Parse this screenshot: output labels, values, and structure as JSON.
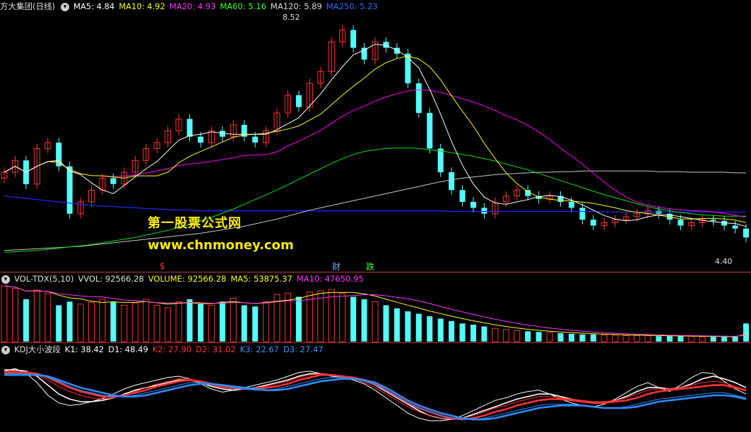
{
  "price_header": {
    "title": "方大集团(日线)",
    "ma5": "MA5: 4.84",
    "ma10": "MA10: 4.92",
    "ma20": "MA20: 4.93",
    "ma60": "MA60: 5.16",
    "ma120": "MA120: 5.89",
    "ma250": "MA250: 5.23"
  },
  "vol_header": {
    "title": "VOL-TDX(5,10)",
    "vvol": "VVOL: 92566.28",
    "volume": "VOLUME: 92566.28",
    "ma5": "MA5: 53875.37",
    "ma10": "MA10: 47650.95"
  },
  "kdj_header": {
    "title": "KDJ大小波段",
    "k1": "K1: 38.42",
    "d1": "D1: 48.49",
    "k2": "K2: 27.90",
    "d2": "D2: 31.02",
    "k3": "K3: 22.67",
    "d3": "D3: 27.47"
  },
  "watermark": {
    "line1": "第一股票公式网",
    "line2": "www.chnmoney.com"
  },
  "markers": {
    "dollar": "$",
    "cai": "财",
    "die": "跌"
  },
  "colors": {
    "up": "#ff3232",
    "down": "#54ffff",
    "ma5": "#ffffff",
    "ma10": "#ffff00",
    "ma20": "#ff00ff",
    "ma60": "#00e400",
    "ma120": "#c8c8c8",
    "ma250": "#2828ff"
  },
  "chart_data": [
    {
      "type": "candlestick",
      "title": "方大集团(日线)",
      "y_range": [
        4.4,
        8.52
      ],
      "annotations": [
        {
          "label": "8.52",
          "value": 8.52
        },
        {
          "label": "4.40",
          "value": 4.4
        }
      ],
      "close": [
        5.9,
        6.1,
        5.7,
        6.3,
        6.4,
        6.0,
        5.2,
        5.4,
        5.6,
        5.8,
        5.7,
        5.9,
        6.1,
        6.3,
        6.4,
        6.6,
        6.8,
        6.5,
        6.4,
        6.6,
        6.5,
        6.7,
        6.5,
        6.4,
        6.6,
        6.9,
        7.2,
        7.0,
        7.4,
        7.6,
        8.1,
        8.3,
        8.0,
        7.8,
        8.1,
        8.0,
        7.9,
        7.4,
        6.9,
        6.3,
        5.9,
        5.6,
        5.4,
        5.3,
        5.2,
        5.4,
        5.5,
        5.6,
        5.5,
        5.45,
        5.5,
        5.4,
        5.3,
        5.1,
        5.0,
        5.05,
        5.1,
        5.15,
        5.2,
        5.25,
        5.2,
        5.1,
        5.0,
        5.05,
        5.1,
        5.08,
        5.0,
        4.95,
        4.8
      ],
      "ma60": [
        4.55,
        4.56,
        4.57,
        4.58,
        4.6,
        4.62,
        4.64,
        4.66,
        4.68,
        4.71,
        4.74,
        4.77,
        4.8,
        4.84,
        4.88,
        4.92,
        4.97,
        5.02,
        5.08,
        5.14,
        5.21,
        5.28,
        5.36,
        5.44,
        5.52,
        5.6,
        5.69,
        5.78,
        5.87,
        5.96,
        6.05,
        6.13,
        6.2,
        6.25,
        6.28,
        6.3,
        6.31,
        6.31,
        6.3,
        6.28,
        6.26,
        6.23,
        6.2,
        6.17,
        6.13,
        6.09,
        6.04,
        5.99,
        5.94,
        5.88,
        5.82,
        5.76,
        5.7,
        5.64,
        5.58,
        5.52,
        5.47,
        5.42,
        5.37,
        5.32,
        5.28,
        5.25,
        5.22,
        5.2,
        5.18,
        5.17,
        5.16,
        5.16,
        5.16
      ],
      "ma120": [
        4.58,
        4.59,
        4.6,
        4.61,
        4.62,
        4.63,
        4.64,
        4.65,
        4.67,
        4.69,
        4.71,
        4.73,
        4.75,
        4.77,
        4.79,
        4.81,
        4.83,
        4.85,
        4.87,
        4.9,
        4.93,
        4.96,
        4.99,
        5.03,
        5.07,
        5.11,
        5.16,
        5.21,
        5.26,
        5.3,
        5.34,
        5.38,
        5.42,
        5.46,
        5.5,
        5.54,
        5.58,
        5.62,
        5.66,
        5.7,
        5.74,
        5.77,
        5.8,
        5.82,
        5.84,
        5.86,
        5.87,
        5.88,
        5.89,
        5.9,
        5.9,
        5.91,
        5.91,
        5.92,
        5.92,
        5.92,
        5.92,
        5.92,
        5.92,
        5.92,
        5.91,
        5.91,
        5.91,
        5.9,
        5.9,
        5.9,
        5.9,
        5.89,
        5.89
      ],
      "ma250": [
        5.5,
        5.48,
        5.46,
        5.44,
        5.42,
        5.4,
        5.38,
        5.36,
        5.34,
        5.33,
        5.32,
        5.31,
        5.3,
        5.29,
        5.28,
        5.27,
        5.26,
        5.26,
        5.25,
        5.25,
        5.25,
        5.25,
        5.25,
        5.25,
        5.25,
        5.25,
        5.25,
        5.25,
        5.25,
        5.25,
        5.25,
        5.25,
        5.25,
        5.25,
        5.25,
        5.25,
        5.25,
        5.25,
        5.25,
        5.25,
        5.25,
        5.24,
        5.24,
        5.24,
        5.24,
        5.24,
        5.24,
        5.24,
        5.24,
        5.24,
        5.24,
        5.24,
        5.24,
        5.24,
        5.24,
        5.23,
        5.23,
        5.23,
        5.23,
        5.23,
        5.23,
        5.23,
        5.23,
        5.23,
        5.23,
        5.23,
        5.23,
        5.23,
        5.23
      ]
    },
    {
      "type": "bar",
      "title": "VOL-TDX(5,10)",
      "values": [
        92,
        88,
        70,
        85,
        80,
        60,
        66,
        62,
        65,
        70,
        66,
        60,
        64,
        70,
        60,
        56,
        66,
        70,
        62,
        60,
        66,
        72,
        60,
        58,
        66,
        78,
        80,
        74,
        82,
        84,
        86,
        80,
        74,
        70,
        66,
        60,
        55,
        50,
        46,
        42,
        38,
        34,
        30,
        28,
        25,
        22,
        20,
        18,
        17,
        16,
        15,
        14,
        13,
        12,
        12,
        11,
        11,
        10,
        10,
        10,
        9,
        9,
        9,
        9,
        8,
        8,
        8,
        8,
        30
      ]
    },
    {
      "type": "line",
      "title": "KDJ大小波段",
      "y_range": [
        0,
        100
      ],
      "series": [
        {
          "name": "K1",
          "values": [
            88,
            92,
            85,
            70,
            50,
            38,
            34,
            36,
            40,
            45,
            52,
            60,
            66,
            70,
            74,
            78,
            80,
            76,
            68,
            60,
            55,
            58,
            62,
            66,
            70,
            74,
            80,
            86,
            88,
            84,
            80,
            78,
            74,
            68,
            58,
            46,
            34,
            22,
            14,
            10,
            10,
            12,
            18,
            26,
            34,
            42,
            46,
            52,
            56,
            58,
            52,
            44,
            38,
            34,
            32,
            36,
            44,
            54,
            64,
            70,
            62,
            56,
            66,
            78,
            86,
            84,
            72,
            60,
            52
          ]
        },
        {
          "name": "D1",
          "values": [
            90,
            90,
            88,
            80,
            66,
            52,
            44,
            40,
            40,
            42,
            46,
            52,
            58,
            62,
            66,
            70,
            74,
            74,
            70,
            64,
            60,
            58,
            60,
            62,
            66,
            70,
            74,
            80,
            84,
            84,
            82,
            80,
            78,
            74,
            66,
            56,
            46,
            36,
            26,
            18,
            14,
            12,
            14,
            20,
            26,
            32,
            38,
            44,
            48,
            52,
            52,
            48,
            44,
            40,
            38,
            38,
            42,
            48,
            56,
            62,
            62,
            60,
            62,
            68,
            76,
            80,
            76,
            70,
            62
          ]
        },
        {
          "name": "K2",
          "values": [
            88,
            88,
            86,
            82,
            74,
            64,
            56,
            50,
            46,
            44,
            46,
            50,
            56,
            62,
            68,
            72,
            76,
            76,
            72,
            66,
            62,
            60,
            60,
            62,
            64,
            68,
            72,
            78,
            82,
            84,
            82,
            80,
            76,
            70,
            62,
            52,
            42,
            32,
            24,
            18,
            14,
            12,
            14,
            18,
            24,
            30,
            34,
            40,
            44,
            48,
            48,
            46,
            44,
            42,
            40,
            40,
            42,
            46,
            52,
            58,
            60,
            60,
            62,
            66,
            70,
            72,
            70,
            64,
            58
          ]
        },
        {
          "name": "D2",
          "values": [
            86,
            86,
            86,
            84,
            78,
            70,
            62,
            56,
            52,
            48,
            48,
            50,
            54,
            58,
            64,
            68,
            72,
            74,
            72,
            68,
            64,
            62,
            60,
            60,
            62,
            64,
            68,
            74,
            78,
            82,
            82,
            80,
            78,
            74,
            68,
            58,
            48,
            38,
            30,
            24,
            18,
            14,
            12,
            14,
            18,
            24,
            28,
            34,
            38,
            42,
            44,
            44,
            42,
            40,
            38,
            38,
            40,
            42,
            46,
            52,
            56,
            58,
            60,
            62,
            64,
            66,
            66,
            62,
            58
          ]
        },
        {
          "name": "K3",
          "values": [
            84,
            84,
            84,
            82,
            78,
            72,
            64,
            58,
            54,
            50,
            48,
            48,
            50,
            54,
            58,
            62,
            66,
            70,
            70,
            68,
            66,
            62,
            60,
            58,
            58,
            60,
            64,
            68,
            72,
            76,
            78,
            78,
            76,
            72,
            66,
            58,
            48,
            38,
            30,
            24,
            18,
            14,
            12,
            12,
            14,
            18,
            22,
            26,
            30,
            34,
            36,
            36,
            36,
            34,
            32,
            30,
            30,
            32,
            36,
            40,
            44,
            46,
            48,
            50,
            52,
            54,
            54,
            50,
            46
          ]
        },
        {
          "name": "D3",
          "values": [
            82,
            82,
            82,
            82,
            80,
            74,
            68,
            62,
            58,
            54,
            50,
            48,
            48,
            50,
            54,
            58,
            62,
            66,
            68,
            68,
            66,
            64,
            62,
            60,
            58,
            58,
            60,
            64,
            68,
            72,
            74,
            76,
            76,
            74,
            70,
            62,
            52,
            42,
            34,
            28,
            22,
            18,
            14,
            12,
            12,
            14,
            18,
            22,
            26,
            30,
            32,
            34,
            34,
            34,
            32,
            30,
            30,
            30,
            32,
            36,
            40,
            42,
            44,
            46,
            48,
            50,
            50,
            48,
            44
          ]
        }
      ]
    }
  ]
}
